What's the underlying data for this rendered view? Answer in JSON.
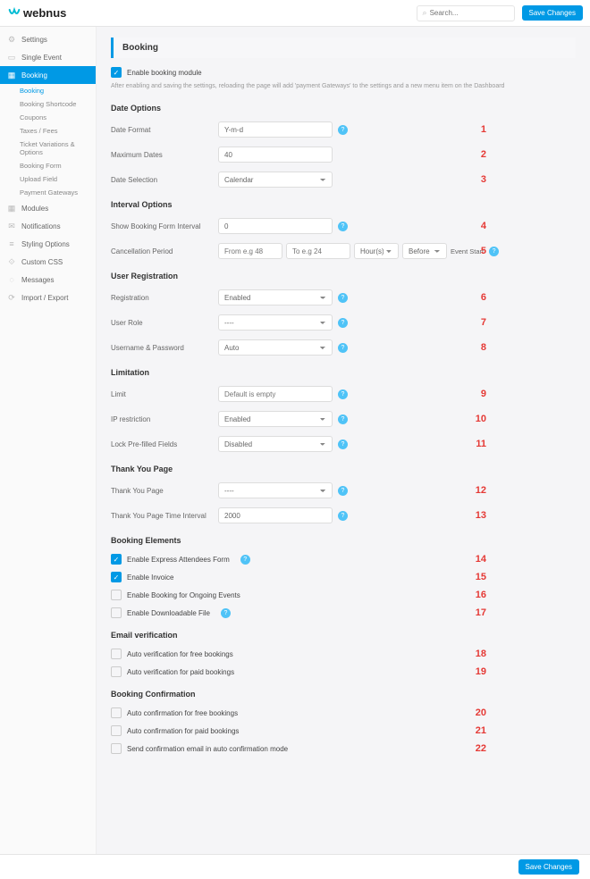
{
  "topbar": {
    "logo_text": "webnus",
    "search_placeholder": "Search...",
    "save_label": "Save Changes"
  },
  "sidebar": {
    "settings": "Settings",
    "single_event": "Single Event",
    "booking": "Booking",
    "sub": {
      "booking": "Booking",
      "shortcode": "Booking Shortcode",
      "coupons": "Coupons",
      "taxes": "Taxes / Fees",
      "variations": "Ticket Variations & Options",
      "form": "Booking Form",
      "upload": "Upload Field",
      "gateways": "Payment Gateways"
    },
    "modules": "Modules",
    "notifications": "Notifications",
    "styling": "Styling Options",
    "custom_css": "Custom CSS",
    "messages": "Messages",
    "import_export": "Import / Export"
  },
  "content": {
    "header": "Booking",
    "enable_label": "Enable booking module",
    "hint": "After enabling and saving the settings, reloading the page will add 'payment Gateways' to the settings and a new menu item on the Dashboard",
    "sec_date": "Date Options",
    "date_format_label": "Date Format",
    "date_format_value": "Y-m-d",
    "max_dates_label": "Maximum Dates",
    "max_dates_value": "40",
    "date_selection_label": "Date Selection",
    "date_selection_value": "Calendar",
    "sec_interval": "Interval Options",
    "show_interval_label": "Show Booking Form Interval",
    "show_interval_value": "0",
    "cancel_period_label": "Cancellation Period",
    "cancel_from_ph": "From e.g 48",
    "cancel_to_ph": "To e.g 24",
    "cancel_unit": "Hour(s)",
    "cancel_before": "Before",
    "cancel_eventstart": "Event Start",
    "sec_userreg": "User Registration",
    "registration_label": "Registration",
    "registration_value": "Enabled",
    "user_role_label": "User Role",
    "user_role_value": "----",
    "username_password_label": "Username & Password",
    "username_password_value": "Auto",
    "sec_limitation": "Limitation",
    "limit_label": "Limit",
    "limit_ph": "Default is empty",
    "ip_label": "IP restriction",
    "ip_value": "Enabled",
    "lock_label": "Lock Pre-filled Fields",
    "lock_value": "Disabled",
    "sec_thankyou": "Thank You Page",
    "thank_page_label": "Thank You Page",
    "thank_page_value": "----",
    "thank_time_label": "Thank You Page Time Interval",
    "thank_time_value": "2000",
    "sec_elements": "Booking Elements",
    "el_express": "Enable Express Attendees Form",
    "el_invoice": "Enable Invoice",
    "el_ongoing": "Enable Booking for Ongoing Events",
    "el_download": "Enable Downloadable File",
    "sec_emailver": "Email verification",
    "ev_free": "Auto verification for free bookings",
    "ev_paid": "Auto verification for paid bookings",
    "sec_confirm": "Booking Confirmation",
    "bc_free": "Auto confirmation for free bookings",
    "bc_paid": "Auto confirmation for paid bookings",
    "bc_email": "Send confirmation email in auto confirmation mode"
  },
  "nums": {
    "n1": "1",
    "n2": "2",
    "n3": "3",
    "n4": "4",
    "n5": "5",
    "n6": "6",
    "n7": "7",
    "n8": "8",
    "n9": "9",
    "n10": "10",
    "n11": "11",
    "n12": "12",
    "n13": "13",
    "n14": "14",
    "n15": "15",
    "n16": "16",
    "n17": "17",
    "n18": "18",
    "n19": "19",
    "n20": "20",
    "n21": "21",
    "n22": "22"
  },
  "footer": {
    "save_label": "Save Changes"
  }
}
